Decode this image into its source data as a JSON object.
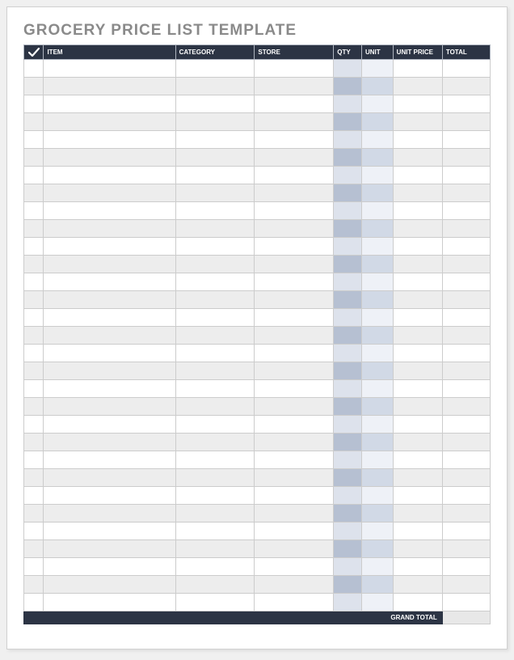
{
  "title": "GROCERY PRICE LIST TEMPLATE",
  "headers": {
    "check": "",
    "item": "ITEM",
    "category": "CATEGORY",
    "store": "STORE",
    "qty": "QTY",
    "unit": "UNIT",
    "unit_price": "UNIT PRICE",
    "total": "TOTAL"
  },
  "rows": [
    {
      "check": "",
      "item": "",
      "category": "",
      "store": "",
      "qty": "",
      "unit": "",
      "unit_price": "",
      "total": ""
    },
    {
      "check": "",
      "item": "",
      "category": "",
      "store": "",
      "qty": "",
      "unit": "",
      "unit_price": "",
      "total": ""
    },
    {
      "check": "",
      "item": "",
      "category": "",
      "store": "",
      "qty": "",
      "unit": "",
      "unit_price": "",
      "total": ""
    },
    {
      "check": "",
      "item": "",
      "category": "",
      "store": "",
      "qty": "",
      "unit": "",
      "unit_price": "",
      "total": ""
    },
    {
      "check": "",
      "item": "",
      "category": "",
      "store": "",
      "qty": "",
      "unit": "",
      "unit_price": "",
      "total": ""
    },
    {
      "check": "",
      "item": "",
      "category": "",
      "store": "",
      "qty": "",
      "unit": "",
      "unit_price": "",
      "total": ""
    },
    {
      "check": "",
      "item": "",
      "category": "",
      "store": "",
      "qty": "",
      "unit": "",
      "unit_price": "",
      "total": ""
    },
    {
      "check": "",
      "item": "",
      "category": "",
      "store": "",
      "qty": "",
      "unit": "",
      "unit_price": "",
      "total": ""
    },
    {
      "check": "",
      "item": "",
      "category": "",
      "store": "",
      "qty": "",
      "unit": "",
      "unit_price": "",
      "total": ""
    },
    {
      "check": "",
      "item": "",
      "category": "",
      "store": "",
      "qty": "",
      "unit": "",
      "unit_price": "",
      "total": ""
    },
    {
      "check": "",
      "item": "",
      "category": "",
      "store": "",
      "qty": "",
      "unit": "",
      "unit_price": "",
      "total": ""
    },
    {
      "check": "",
      "item": "",
      "category": "",
      "store": "",
      "qty": "",
      "unit": "",
      "unit_price": "",
      "total": ""
    },
    {
      "check": "",
      "item": "",
      "category": "",
      "store": "",
      "qty": "",
      "unit": "",
      "unit_price": "",
      "total": ""
    },
    {
      "check": "",
      "item": "",
      "category": "",
      "store": "",
      "qty": "",
      "unit": "",
      "unit_price": "",
      "total": ""
    },
    {
      "check": "",
      "item": "",
      "category": "",
      "store": "",
      "qty": "",
      "unit": "",
      "unit_price": "",
      "total": ""
    },
    {
      "check": "",
      "item": "",
      "category": "",
      "store": "",
      "qty": "",
      "unit": "",
      "unit_price": "",
      "total": ""
    },
    {
      "check": "",
      "item": "",
      "category": "",
      "store": "",
      "qty": "",
      "unit": "",
      "unit_price": "",
      "total": ""
    },
    {
      "check": "",
      "item": "",
      "category": "",
      "store": "",
      "qty": "",
      "unit": "",
      "unit_price": "",
      "total": ""
    },
    {
      "check": "",
      "item": "",
      "category": "",
      "store": "",
      "qty": "",
      "unit": "",
      "unit_price": "",
      "total": ""
    },
    {
      "check": "",
      "item": "",
      "category": "",
      "store": "",
      "qty": "",
      "unit": "",
      "unit_price": "",
      "total": ""
    },
    {
      "check": "",
      "item": "",
      "category": "",
      "store": "",
      "qty": "",
      "unit": "",
      "unit_price": "",
      "total": ""
    },
    {
      "check": "",
      "item": "",
      "category": "",
      "store": "",
      "qty": "",
      "unit": "",
      "unit_price": "",
      "total": ""
    },
    {
      "check": "",
      "item": "",
      "category": "",
      "store": "",
      "qty": "",
      "unit": "",
      "unit_price": "",
      "total": ""
    },
    {
      "check": "",
      "item": "",
      "category": "",
      "store": "",
      "qty": "",
      "unit": "",
      "unit_price": "",
      "total": ""
    },
    {
      "check": "",
      "item": "",
      "category": "",
      "store": "",
      "qty": "",
      "unit": "",
      "unit_price": "",
      "total": ""
    },
    {
      "check": "",
      "item": "",
      "category": "",
      "store": "",
      "qty": "",
      "unit": "",
      "unit_price": "",
      "total": ""
    },
    {
      "check": "",
      "item": "",
      "category": "",
      "store": "",
      "qty": "",
      "unit": "",
      "unit_price": "",
      "total": ""
    },
    {
      "check": "",
      "item": "",
      "category": "",
      "store": "",
      "qty": "",
      "unit": "",
      "unit_price": "",
      "total": ""
    },
    {
      "check": "",
      "item": "",
      "category": "",
      "store": "",
      "qty": "",
      "unit": "",
      "unit_price": "",
      "total": ""
    },
    {
      "check": "",
      "item": "",
      "category": "",
      "store": "",
      "qty": "",
      "unit": "",
      "unit_price": "",
      "total": ""
    },
    {
      "check": "",
      "item": "",
      "category": "",
      "store": "",
      "qty": "",
      "unit": "",
      "unit_price": "",
      "total": ""
    }
  ],
  "footer": {
    "grand_total_label": "GRAND TOTAL",
    "grand_total_value": ""
  }
}
